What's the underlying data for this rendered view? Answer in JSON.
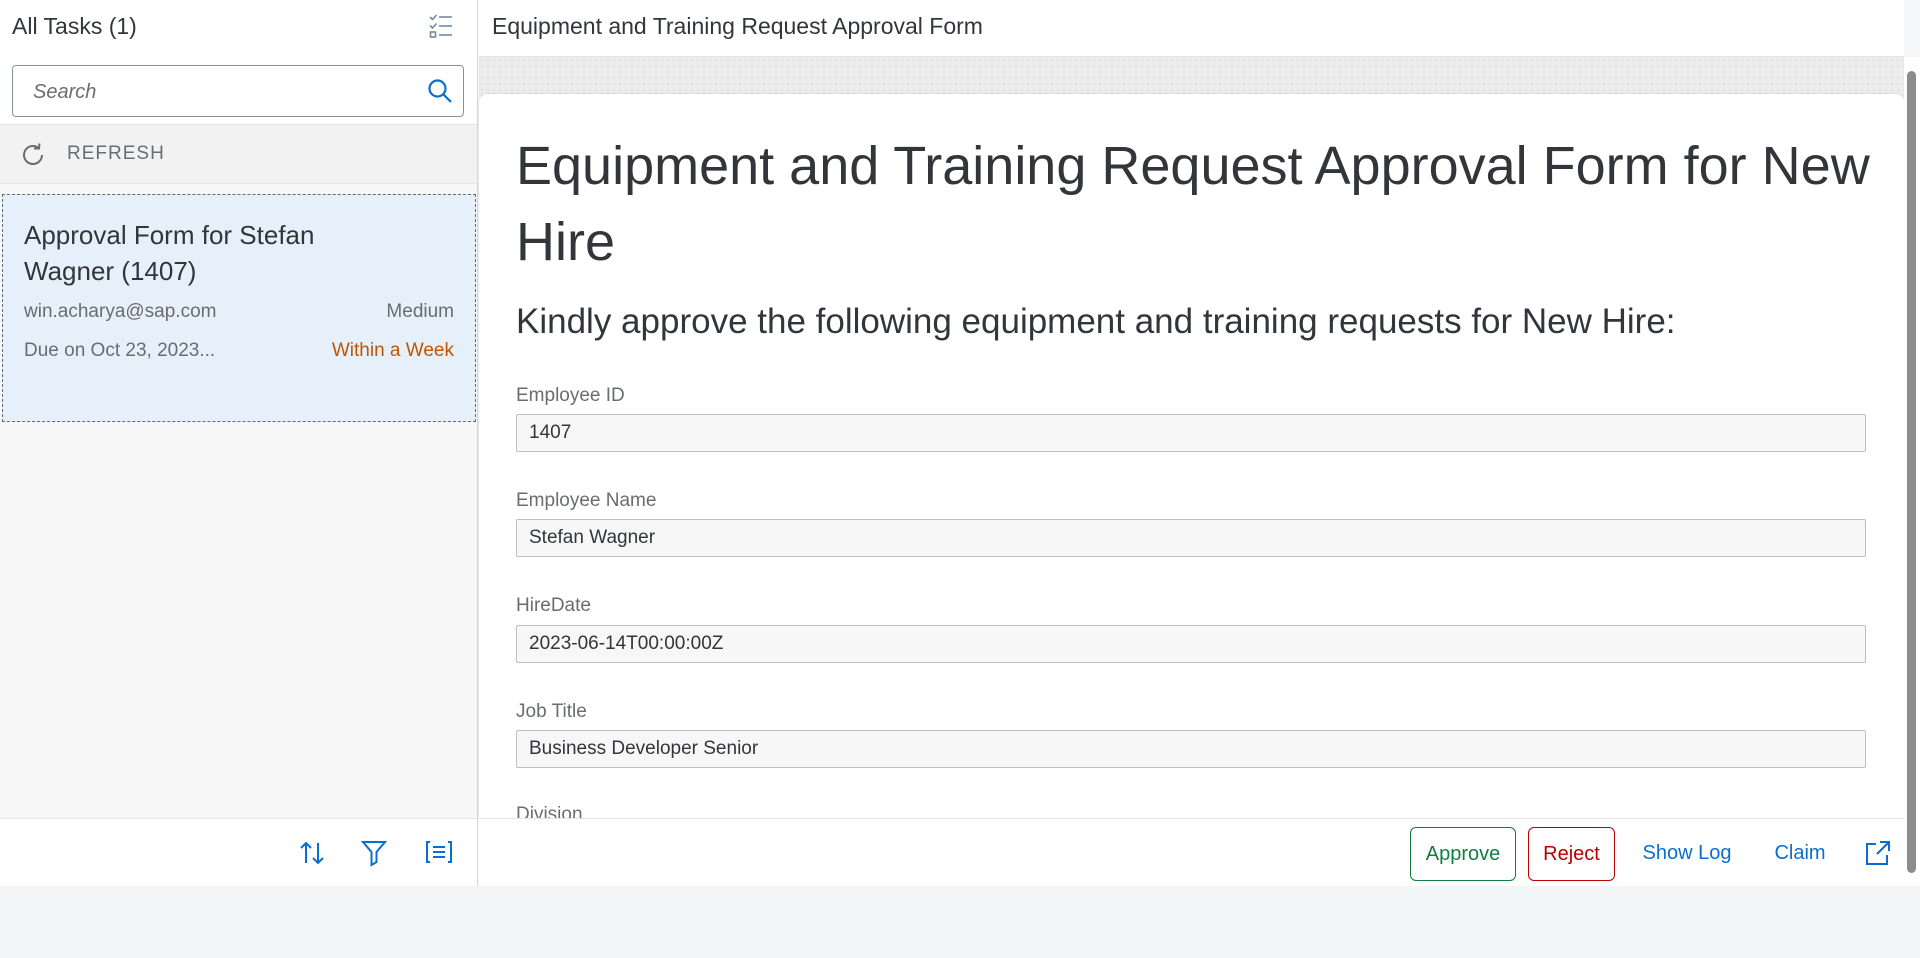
{
  "master": {
    "title": "All Tasks (1)",
    "search": {
      "placeholder": "Search",
      "value": ""
    },
    "refresh_label": "REFRESH",
    "tasks": [
      {
        "title": "Approval Form for Stefan Wagner (1407)",
        "created_by": "win.acharya@sap.com",
        "priority": "Medium",
        "due": "Due on Oct 23, 2023...",
        "due_status": "Within a Week"
      }
    ]
  },
  "detail": {
    "title": "Equipment and Training Request Approval Form",
    "form": {
      "heading": "Equipment and Training Request Approval Form for New Hire",
      "intro": "Kindly approve the following equipment and training requests for New Hire:",
      "fields": [
        {
          "label": "Employee ID",
          "value": "1407"
        },
        {
          "label": "Employee Name",
          "value": "Stefan Wagner"
        },
        {
          "label": "HireDate",
          "value": "2023-06-14T00:00:00Z"
        },
        {
          "label": "Job Title",
          "value": "Business Developer Senior"
        },
        {
          "label": "Division",
          "value": ""
        }
      ]
    },
    "actions": {
      "approve": "Approve",
      "reject": "Reject",
      "show_log": "Show Log",
      "claim": "Claim"
    }
  },
  "icons": {
    "multiselect": "multiselect-icon",
    "search": "search-icon",
    "refresh": "refresh-icon",
    "sort": "sort-icon",
    "filter": "filter-icon",
    "group": "group-icon",
    "share": "share-icon"
  },
  "colors": {
    "accent": "#0a6ed1",
    "approve": "#107e3e",
    "reject": "#bb0000",
    "due_status": "#c35500",
    "selected_item_bg": "#e5f0fa"
  }
}
